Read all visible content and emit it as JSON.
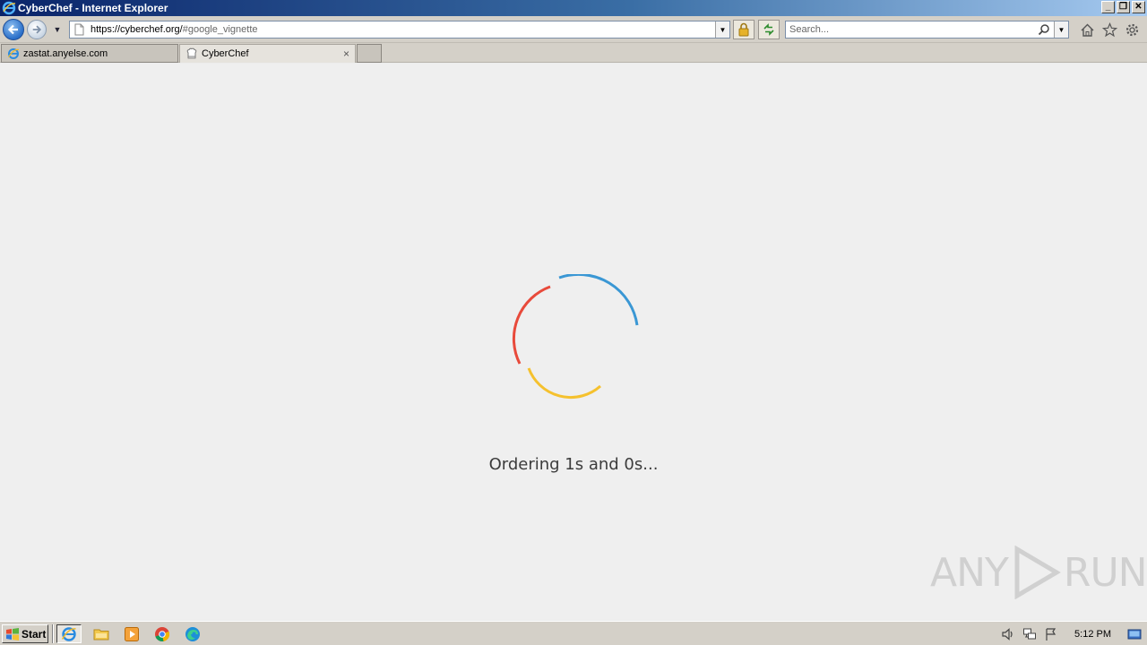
{
  "window": {
    "title": "CyberChef - Internet Explorer",
    "controls": {
      "minimize": "_",
      "restore": "❐",
      "close": "✕"
    }
  },
  "nav": {
    "url_main": "https://cyberchef.org/",
    "url_hash": "#google_vignette",
    "search_placeholder": "Search..."
  },
  "tabs": [
    {
      "label": "zastat.anyelse.com",
      "icon": "ie-icon",
      "active": false
    },
    {
      "label": "CyberChef",
      "icon": "cyberchef-icon",
      "active": true,
      "close": "×"
    }
  ],
  "content": {
    "loading_text": "Ordering 1s and 0s...",
    "spinner_colors": {
      "red": "#e84a3b",
      "blue": "#3a97d4",
      "yellow": "#f5c12e"
    },
    "watermark": {
      "left": "ANY",
      "right": "RUN"
    }
  },
  "taskbar": {
    "start_label": "Start",
    "apps": [
      "internet-explorer",
      "file-explorer",
      "media-player",
      "chrome",
      "edge"
    ],
    "clock": "5:12 PM"
  }
}
